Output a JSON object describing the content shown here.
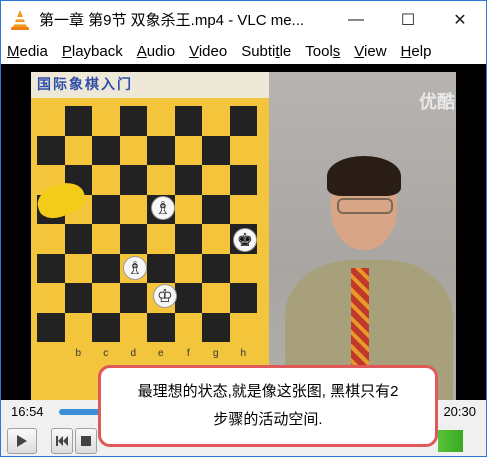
{
  "window": {
    "title": "第一章 第9节 双象杀王.mp4 - VLC me...",
    "minimize_glyph": "—",
    "maximize_glyph": "☐",
    "close_glyph": "✕"
  },
  "menu": [
    {
      "label": "Media",
      "accel_index": 0
    },
    {
      "label": "Playback",
      "accel_index": 0
    },
    {
      "label": "Audio",
      "accel_index": 0
    },
    {
      "label": "Video",
      "accel_index": 0
    },
    {
      "label": "Subtitle",
      "accel_index": 5
    },
    {
      "label": "Tools",
      "accel_index": 4
    },
    {
      "label": "View",
      "accel_index": 0
    },
    {
      "label": "Help",
      "accel_index": 0
    }
  ],
  "video": {
    "board_header": "国际象棋入门",
    "files": [
      "b",
      "c",
      "d",
      "e",
      "f",
      "g",
      "h"
    ],
    "watermark": "优酷"
  },
  "subtitle": {
    "line1": "最理想的状态,就是像这张图, 黑棋只有2",
    "line2": "步骤的活动空间."
  },
  "playback": {
    "elapsed": "16:54",
    "total": "20:30",
    "progress_fraction": 0.82,
    "volume_fraction": 0.9
  },
  "icons": {
    "play": "play-icon",
    "prev": "previous-icon",
    "stop": "stop-icon",
    "volume": "volume-icon"
  }
}
